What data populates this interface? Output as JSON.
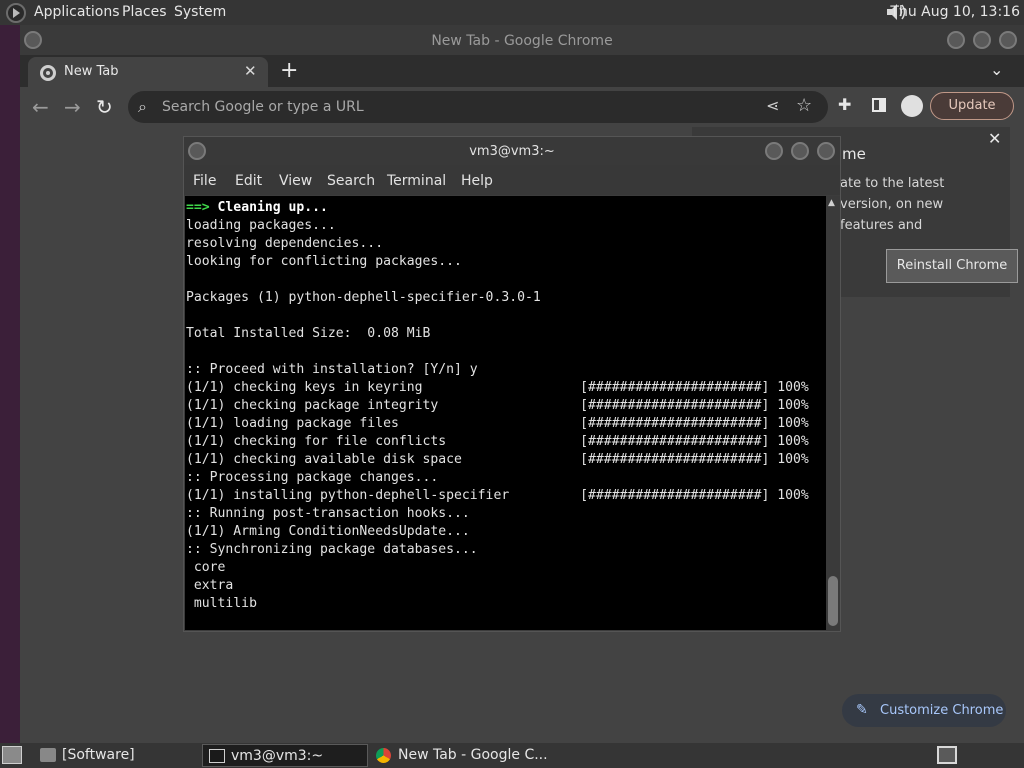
{
  "top_panel": {
    "menus": [
      "Applications",
      "Places",
      "System"
    ],
    "clock": "Thu Aug 10, 13:16"
  },
  "chrome": {
    "window_title": "New Tab - Google Chrome",
    "tab_label": "New Tab",
    "omnibox_placeholder": "Search Google or type a URL",
    "update_label": "Update",
    "bubble_title": "me",
    "bubble_body": "ate to the latest version, on new features and",
    "reinstall_label": "Reinstall Chrome",
    "customize_label": "Customize Chrome"
  },
  "terminal": {
    "title": "vm3@vm3:~",
    "menus": [
      "File",
      "Edit",
      "View",
      "Search",
      "Terminal",
      "Help"
    ],
    "heading_arrow": "==>",
    "heading_text": " Cleaning up...",
    "lines": [
      "loading packages...",
      "resolving dependencies...",
      "looking for conflicting packages...",
      "",
      "Packages (1) python-dephell-specifier-0.3.0-1",
      "",
      "Total Installed Size:  0.08 MiB",
      "",
      ":: Proceed with installation? [Y/n] y",
      "(1/1) checking keys in keyring                    [######################] 100%",
      "(1/1) checking package integrity                  [######################] 100%",
      "(1/1) loading package files                       [######################] 100%",
      "(1/1) checking for file conflicts                 [######################] 100%",
      "(1/1) checking available disk space               [######################] 100%",
      ":: Processing package changes...",
      "(1/1) installing python-dephell-specifier         [######################] 100%",
      ":: Running post-transaction hooks...",
      "(1/1) Arming ConditionNeedsUpdate...",
      ":: Synchronizing package databases...",
      " core",
      " extra",
      " multilib"
    ]
  },
  "taskbar": {
    "tasks": [
      "[Software]",
      "vm3@vm3:~",
      "New Tab - Google C..."
    ]
  }
}
